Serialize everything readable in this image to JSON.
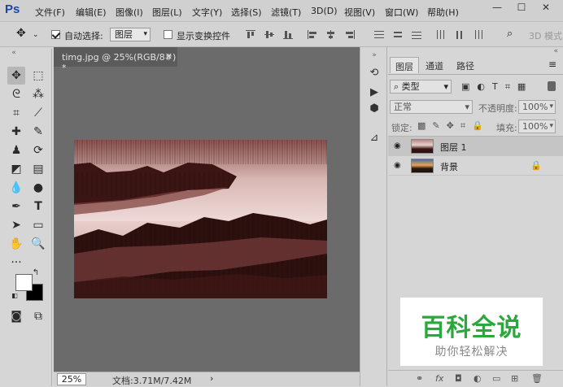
{
  "app": {
    "logo": "Ps"
  },
  "menu": [
    "文件(F)",
    "编辑(E)",
    "图像(I)",
    "图层(L)",
    "文字(Y)",
    "选择(S)",
    "滤镜(T)",
    "3D(D)",
    "视图(V)",
    "窗口(W)",
    "帮助(H)"
  ],
  "window_controls": {
    "minimize": "—",
    "maximize": "☐",
    "close": "✕"
  },
  "options": {
    "auto_select_label": "自动选择:",
    "auto_select_checked": true,
    "auto_select_value": "图层",
    "show_transform_label": "显示变换控件",
    "show_transform_checked": false,
    "mode_3d_label": "3D 模式"
  },
  "document": {
    "tab_title": "timg.jpg @ 25%(RGB/8#) *",
    "zoom": "25%",
    "doc_info": "文档:3.71M/7.42M"
  },
  "layers_panel": {
    "tabs": [
      "图层",
      "通道",
      "路径"
    ],
    "filter_label": "类型",
    "blend_mode": "正常",
    "opacity_label": "不透明度:",
    "opacity_value": "100%",
    "lock_label": "锁定:",
    "fill_label": "填充:",
    "fill_value": "100%",
    "layers": [
      {
        "name": "图层 1"
      },
      {
        "name": "背景"
      }
    ]
  },
  "watermark": {
    "title": "百科全说",
    "subtitle": "助你轻松解决"
  }
}
